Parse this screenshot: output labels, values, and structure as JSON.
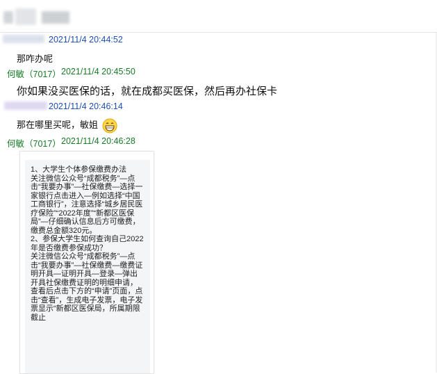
{
  "chat": {
    "messages": [
      {
        "sender_visible": "",
        "time": "2021/11/4 20:44:52",
        "text": "那咋办呢"
      },
      {
        "sender_visible": "何敏（7017）",
        "time": "2021/11/4 20:45:50",
        "text": "你如果没买医保的话，就在成都买医保，然后再办社保卡"
      },
      {
        "sender_visible": "",
        "time": "2021/11/4 20:46:14",
        "text": "那在哪里买呢，敏姐"
      },
      {
        "sender_visible": "何敏（7017）",
        "time": "2021/11/4 20:46:28",
        "text": ""
      }
    ],
    "image_text": "1、大学生个体参保缴费办法\n关注微信公众号“成都税务”—点击“我要办事”—社保缴费—选择一家银行点击进入—例如选择“中国工商银行”，注意选择“城乡居民医疗保险”“2022年度”“新都区医保局”—仔细确认信息后方可缴费，缴费总金额320元。\n2、参保大学生如何查询自己2022年是否缴费参保成功？\n关注微信公众号“成都税务”—点击“我要办事”—社保缴费—缴费证明开具—证明开具—登录—弹出开具社保缴费证明的明细申请，查看后点击下方的“申请”页面，点击“查看”，生成电子发票，电子发票显示“新都区医保局，所属期限截止"
  },
  "icons": {
    "emoji": "grin-emoji-icon"
  },
  "colors": {
    "other_meta": "#1b4fb3",
    "my_meta": "#177a26"
  }
}
